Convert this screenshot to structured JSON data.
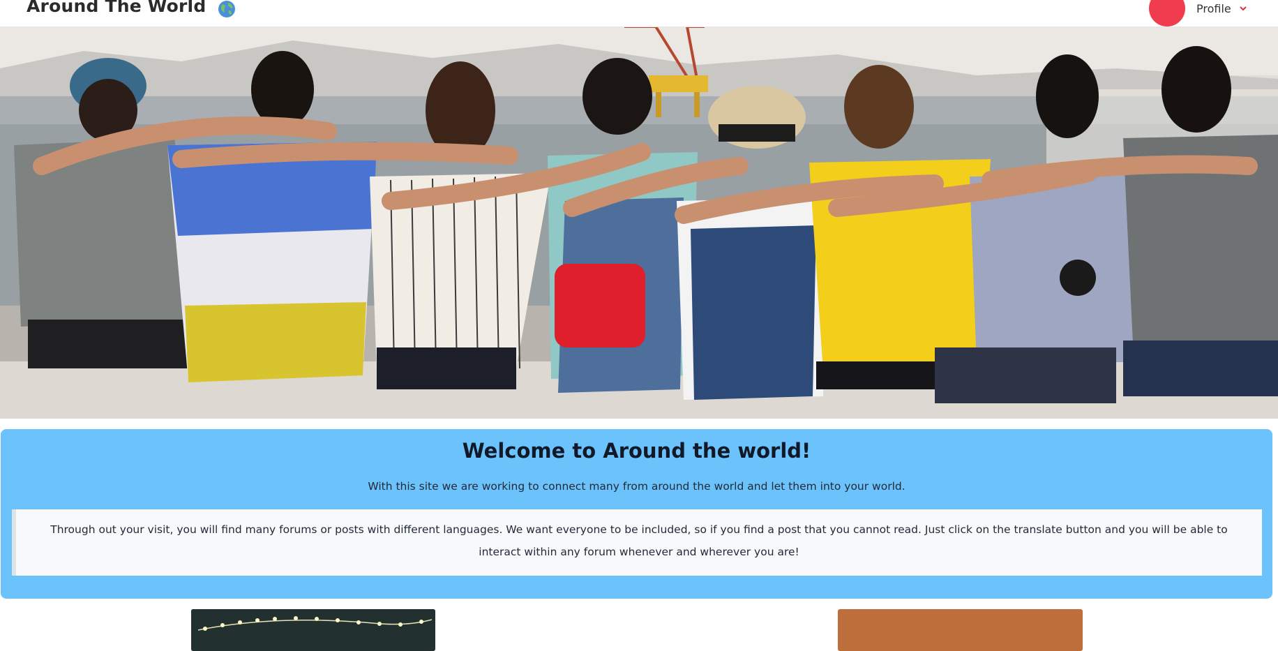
{
  "navbar": {
    "brand": "Around The World",
    "brand_icon": "globe-icon",
    "profile_label": "Profile",
    "profile_icon": "chevron-down-icon",
    "avatar_color": "#f03c4e"
  },
  "hero": {
    "image": "group-of-friends-sitting-by-the-sea-photo"
  },
  "welcome": {
    "title": "Welcome to Around the world!",
    "subtitle": "With this site we are working to connect many from around the world and let them into your world.",
    "note": "Through out your visit, you will find many forums or posts with different languages. We want everyone to be included, so if you find a post that you cannot read. Just click on the translate button and you will be able to interact within any forum whenever and wherever you are!",
    "background": "#6cc3fb"
  },
  "cards": [
    {
      "name": "left-card-image",
      "color": "#1f2a2a"
    },
    {
      "name": "right-card-image",
      "color": "#bd6e3a"
    }
  ]
}
